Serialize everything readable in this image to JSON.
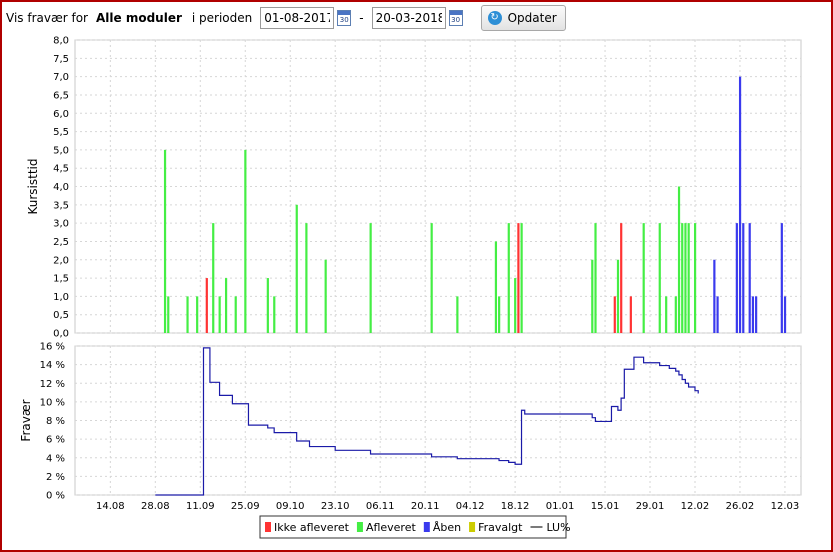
{
  "toolbar": {
    "prefix": "Vis fravær for",
    "module": "Alle moduler",
    "period_label": "i perioden",
    "date_from": "01-08-2017",
    "separator": "-",
    "date_to": "20-03-2018",
    "calendar_icon_text": "30",
    "calendar_icon": "calendar-icon",
    "refresh_icon": "refresh-icon",
    "update_button": "Opdater"
  },
  "colors": {
    "frame": "#b00000",
    "ikke_afleveret": "#ff3333",
    "afleveret": "#44ee44",
    "aaben": "#3a3aee",
    "fravalgt": "#cccc00",
    "lu_line": "#1a1aa8"
  },
  "chart_data": [
    {
      "type": "bar",
      "ylabel": "Kursisttid",
      "ylim": [
        0,
        8
      ],
      "yticks": [
        "0,0",
        "0,5",
        "1,0",
        "1,5",
        "2,0",
        "2,5",
        "3,0",
        "3,5",
        "4,0",
        "4,5",
        "5,0",
        "5,5",
        "6,0",
        "6,5",
        "7,0",
        "7,5",
        "8,0"
      ],
      "grid": true,
      "series": [
        {
          "name": "Ikke afleveret",
          "points": [
            [
              "2017-09-13",
              1.5
            ],
            [
              "2017-12-19",
              3
            ],
            [
              "2018-01-18",
              1
            ],
            [
              "2018-01-20",
              3
            ],
            [
              "2018-01-23",
              1
            ]
          ]
        },
        {
          "name": "Afleveret",
          "points": [
            [
              "2017-08-31",
              5
            ],
            [
              "2017-09-01",
              1
            ],
            [
              "2017-09-07",
              1
            ],
            [
              "2017-09-10",
              1
            ],
            [
              "2017-09-15",
              3
            ],
            [
              "2017-09-17",
              1
            ],
            [
              "2017-09-19",
              1.5
            ],
            [
              "2017-09-22",
              1
            ],
            [
              "2017-09-25",
              5
            ],
            [
              "2017-10-02",
              1.5
            ],
            [
              "2017-10-04",
              1
            ],
            [
              "2017-10-11",
              3.5
            ],
            [
              "2017-10-14",
              3
            ],
            [
              "2017-10-20",
              2
            ],
            [
              "2017-11-03",
              3
            ],
            [
              "2017-11-22",
              3
            ],
            [
              "2017-11-30",
              1
            ],
            [
              "2017-12-12",
              2.5
            ],
            [
              "2017-12-13",
              1
            ],
            [
              "2017-12-16",
              3
            ],
            [
              "2017-12-18",
              1.5
            ],
            [
              "2017-12-20",
              3
            ],
            [
              "2018-01-11",
              2
            ],
            [
              "2018-01-12",
              3
            ],
            [
              "2018-01-19",
              2
            ],
            [
              "2018-01-27",
              3
            ],
            [
              "2018-02-01",
              3
            ],
            [
              "2018-02-03",
              1
            ],
            [
              "2018-02-06",
              1
            ],
            [
              "2018-02-07",
              4
            ],
            [
              "2018-02-08",
              3
            ],
            [
              "2018-02-09",
              3
            ],
            [
              "2018-02-10",
              3
            ],
            [
              "2018-02-12",
              3
            ]
          ]
        },
        {
          "name": "Åben",
          "points": [
            [
              "2018-02-18",
              2
            ],
            [
              "2018-02-19",
              1
            ],
            [
              "2018-02-25",
              3
            ],
            [
              "2018-02-26",
              7
            ],
            [
              "2018-02-27",
              3
            ],
            [
              "2018-03-01",
              3
            ],
            [
              "2018-03-02",
              1
            ],
            [
              "2018-03-03",
              1
            ],
            [
              "2018-03-11",
              3
            ],
            [
              "2018-03-12",
              1
            ]
          ]
        },
        {
          "name": "Fravalgt",
          "points": []
        }
      ]
    },
    {
      "type": "line",
      "ylabel": "Fravær",
      "ylim": [
        0,
        16
      ],
      "yticks": [
        "0 %",
        "2 %",
        "4 %",
        "6 %",
        "8 %",
        "10 %",
        "12 %",
        "14 %",
        "16 %"
      ],
      "xticks": [
        "14.08",
        "28.08",
        "11.09",
        "25.09",
        "09.10",
        "23.10",
        "06.11",
        "20.11",
        "04.12",
        "18.12",
        "01.01",
        "15.01",
        "29.01",
        "12.02",
        "26.02",
        "12.03"
      ],
      "xlim": [
        "2017-08-03",
        "2018-03-17"
      ],
      "grid": true,
      "series": [
        {
          "name": "LU%",
          "step": true,
          "points": [
            [
              "2017-08-28",
              0
            ],
            [
              "2017-09-12",
              15.8
            ],
            [
              "2017-09-14",
              12.1
            ],
            [
              "2017-09-17",
              10.7
            ],
            [
              "2017-09-21",
              9.8
            ],
            [
              "2017-09-26",
              7.5
            ],
            [
              "2017-10-02",
              7.2
            ],
            [
              "2017-10-04",
              6.7
            ],
            [
              "2017-10-11",
              5.8
            ],
            [
              "2017-10-15",
              5.2
            ],
            [
              "2017-10-23",
              4.8
            ],
            [
              "2017-11-03",
              4.4
            ],
            [
              "2017-11-22",
              4.1
            ],
            [
              "2017-11-30",
              3.9
            ],
            [
              "2017-12-13",
              3.7
            ],
            [
              "2017-12-16",
              3.5
            ],
            [
              "2017-12-18",
              3.3
            ],
            [
              "2017-12-20",
              9.1
            ],
            [
              "2017-12-21",
              8.7
            ],
            [
              "2018-01-11",
              8.3
            ],
            [
              "2018-01-12",
              7.9
            ],
            [
              "2018-01-17",
              9.5
            ],
            [
              "2018-01-19",
              9.1
            ],
            [
              "2018-01-20",
              10.4
            ],
            [
              "2018-01-21",
              13.5
            ],
            [
              "2018-01-24",
              14.8
            ],
            [
              "2018-01-27",
              14.2
            ],
            [
              "2018-02-01",
              13.9
            ],
            [
              "2018-02-04",
              13.6
            ],
            [
              "2018-02-06",
              13.3
            ],
            [
              "2018-02-07",
              12.9
            ],
            [
              "2018-02-08",
              12.4
            ],
            [
              "2018-02-09",
              12.0
            ],
            [
              "2018-02-10",
              11.6
            ],
            [
              "2018-02-12",
              11.2
            ],
            [
              "2018-02-13",
              10.9
            ]
          ]
        }
      ]
    }
  ],
  "legend": [
    {
      "label": "Ikke afleveret",
      "kind": "square",
      "color": "#ff3333"
    },
    {
      "label": "Afleveret",
      "kind": "square",
      "color": "#44ee44"
    },
    {
      "label": "Åben",
      "kind": "square",
      "color": "#3a3aee"
    },
    {
      "label": "Fravalgt",
      "kind": "square",
      "color": "#cccc00"
    },
    {
      "label": "LU%",
      "kind": "line",
      "color": "#1a1aa8"
    }
  ]
}
